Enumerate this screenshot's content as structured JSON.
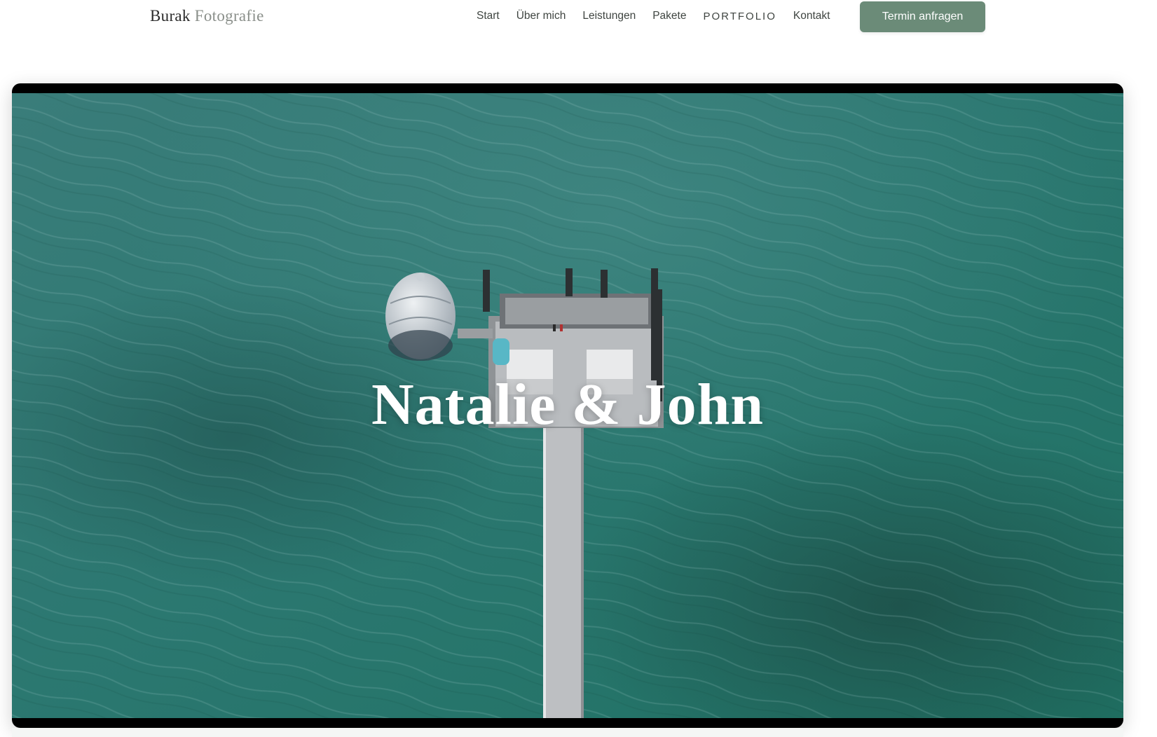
{
  "header": {
    "logo_first": "Burak",
    "logo_second": "Fotografie",
    "nav": [
      {
        "label": "Start"
      },
      {
        "label": "Über mich"
      },
      {
        "label": "Leistungen"
      },
      {
        "label": "Pakete"
      },
      {
        "label": "PORTFOLIO"
      },
      {
        "label": "Kontakt"
      }
    ],
    "cta_label": "Termin anfragen"
  },
  "hero": {
    "title": "Natalie & John"
  },
  "colors": {
    "accent": "#6b8b78",
    "sea": "#2f7a72",
    "pier": "#bfc0c2"
  },
  "icons": [
    "diving-gondola",
    "pier"
  ]
}
